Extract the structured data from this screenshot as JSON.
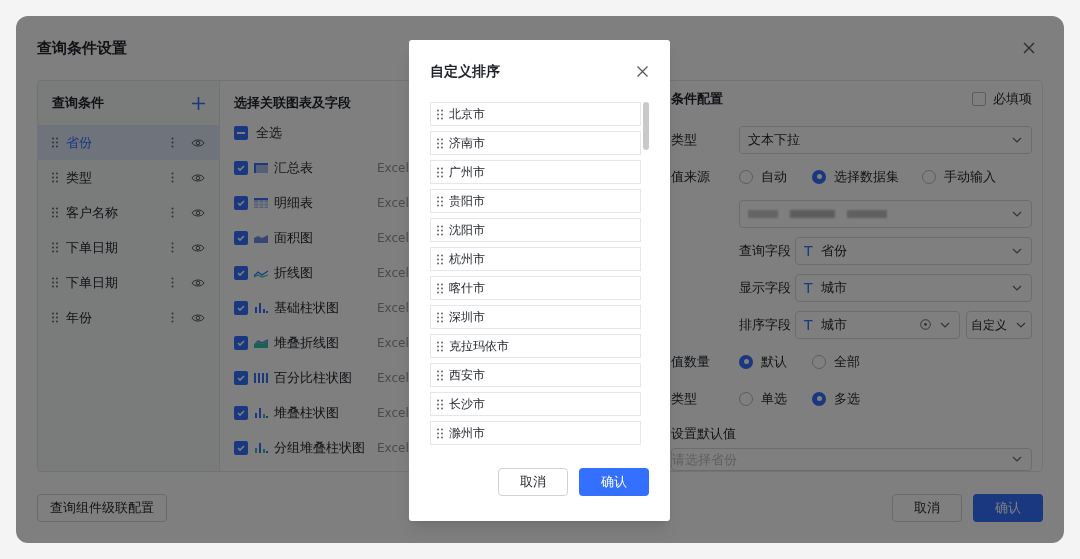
{
  "dialog": {
    "title": "查询条件设置",
    "conditions": {
      "title": "查询条件",
      "items": [
        {
          "label": "省份",
          "selected": true
        },
        {
          "label": "类型",
          "selected": false
        },
        {
          "label": "客户名称",
          "selected": false
        },
        {
          "label": "下单日期",
          "selected": false
        },
        {
          "label": "下单日期",
          "selected": false
        },
        {
          "label": "年份",
          "selected": false
        }
      ]
    },
    "charts": {
      "title": "选择关联图表及字段",
      "select_all": {
        "label": "全选",
        "indeterminate": true
      },
      "items": [
        {
          "kind": "summary-table",
          "label": "汇总表",
          "checked": true,
          "source": "Excel"
        },
        {
          "kind": "detail-table",
          "label": "明细表",
          "checked": true,
          "source": "Excel"
        },
        {
          "kind": "area",
          "label": "面积图",
          "checked": true,
          "source": "Excel"
        },
        {
          "kind": "line",
          "label": "折线图",
          "checked": true,
          "source": "Excel"
        },
        {
          "kind": "bar",
          "label": "基础柱状图",
          "checked": true,
          "source": "Excel"
        },
        {
          "kind": "stacked-line",
          "label": "堆叠折线图",
          "checked": true,
          "source": "Excel"
        },
        {
          "kind": "percent-bar",
          "label": "百分比柱状图",
          "checked": true,
          "source": "Excel"
        },
        {
          "kind": "stacked-bar",
          "label": "堆叠柱状图",
          "checked": true,
          "source": "Excel"
        },
        {
          "kind": "grouped-bar",
          "label": "分组堆叠柱状图",
          "checked": true,
          "source": "Excel"
        }
      ]
    },
    "config": {
      "title": "条件配置",
      "required": {
        "label": "必填项",
        "checked": false
      },
      "type": {
        "label": "类型",
        "value": "文本下拉"
      },
      "value_source": {
        "label": "值来源",
        "options": [
          {
            "label": "自动",
            "selected": false
          },
          {
            "label": "选择数据集",
            "selected": true
          },
          {
            "label": "手动输入",
            "selected": false
          }
        ]
      },
      "query_field": {
        "label": "查询字段",
        "type_icon": "T",
        "value": "省份"
      },
      "display_field": {
        "label": "显示字段",
        "type_icon": "T",
        "value": "城市"
      },
      "sort_field": {
        "label": "排序字段",
        "type_icon": "T",
        "value": "城市",
        "order": "自定义"
      },
      "value_count": {
        "label": "值数量",
        "options": [
          {
            "label": "默认",
            "selected": true
          },
          {
            "label": "全部",
            "selected": false
          }
        ]
      },
      "select_type": {
        "label": "类型",
        "options": [
          {
            "label": "单选",
            "selected": false
          },
          {
            "label": "多选",
            "selected": true
          }
        ]
      },
      "default_value": {
        "label": "设置默认值",
        "placeholder": "请选择省份"
      }
    },
    "cascade_button": "查询组件级联配置",
    "cancel": "取消",
    "confirm": "确认"
  },
  "modal": {
    "title": "自定义排序",
    "items": [
      "北京市",
      "济南市",
      "广州市",
      "贵阳市",
      "沈阳市",
      "杭州市",
      "喀什市",
      "深圳市",
      "克拉玛依市",
      "西安市",
      "长沙市",
      "滁州市"
    ],
    "cancel": "取消",
    "confirm": "确认"
  }
}
